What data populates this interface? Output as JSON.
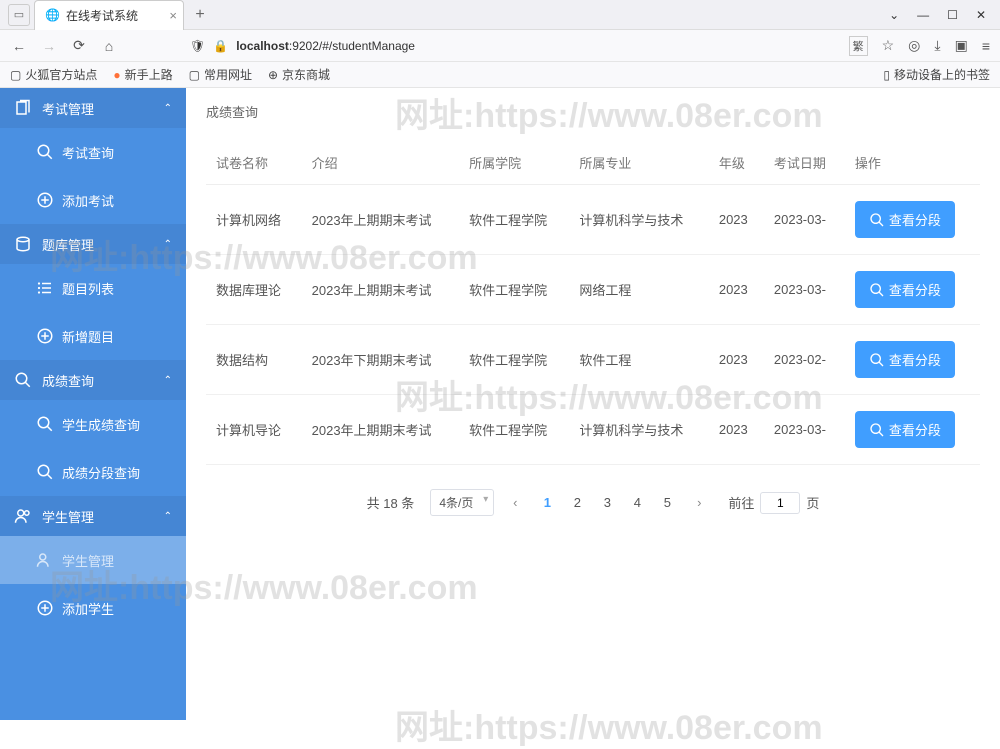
{
  "browser": {
    "tab_title": "在线考试系统",
    "url": "localhost:9202/#/studentManage",
    "bookmarks": [
      "火狐官方站点",
      "新手上路",
      "常用网址",
      "京东商城"
    ],
    "bookmark_right": "移动设备上的书签"
  },
  "sidebar": {
    "groups": [
      {
        "title": "考试管理",
        "items": [
          {
            "label": "考试查询"
          },
          {
            "label": "添加考试"
          }
        ]
      },
      {
        "title": "题库管理",
        "items": [
          {
            "label": "题目列表"
          },
          {
            "label": "新增题目"
          }
        ]
      },
      {
        "title": "成绩查询",
        "items": [
          {
            "label": "学生成绩查询"
          },
          {
            "label": "成绩分段查询"
          }
        ]
      },
      {
        "title": "学生管理",
        "items": [
          {
            "label": "学生管理"
          },
          {
            "label": "添加学生"
          }
        ]
      }
    ]
  },
  "breadcrumb": "成绩查询",
  "table": {
    "headers": [
      "试卷名称",
      "介绍",
      "所属学院",
      "所属专业",
      "年级",
      "考试日期",
      "操作"
    ],
    "rows": [
      {
        "name": "计算机网络",
        "intro": "2023年上期期末考试",
        "college": "软件工程学院",
        "major": "计算机科学与技术",
        "grade": "2023",
        "date": "2023-03-",
        "action": "查看分段"
      },
      {
        "name": "数据库理论",
        "intro": "2023年上期期末考试",
        "college": "软件工程学院",
        "major": "网络工程",
        "grade": "2023",
        "date": "2023-03-",
        "action": "查看分段"
      },
      {
        "name": "数据结构",
        "intro": "2023年下期期末考试",
        "college": "软件工程学院",
        "major": "软件工程",
        "grade": "2023",
        "date": "2023-02-",
        "action": "查看分段"
      },
      {
        "name": "计算机导论",
        "intro": "2023年上期期末考试",
        "college": "软件工程学院",
        "major": "计算机科学与技术",
        "grade": "2023",
        "date": "2023-03-",
        "action": "查看分段"
      }
    ]
  },
  "pagination": {
    "total_text": "共 18 条",
    "page_size": "4条/页",
    "pages": [
      "1",
      "2",
      "3",
      "4",
      "5"
    ],
    "goto_prefix": "前往",
    "goto_value": "1",
    "goto_suffix": "页"
  },
  "watermark": "网址:https://www.08er.com"
}
